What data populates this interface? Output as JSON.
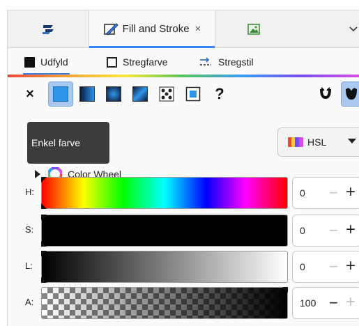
{
  "tabs": [
    {
      "label": "",
      "icon": "layers-icon"
    },
    {
      "label": "Fill and Stroke",
      "icon": "fill-stroke-icon",
      "close": "×",
      "active": true
    },
    {
      "label": "",
      "icon": "image-icon"
    }
  ],
  "more_menu_icon": "chevron-down-icon",
  "subtabs": [
    {
      "label": "Udfyld",
      "icon": "filled-square-icon",
      "active": true
    },
    {
      "label": "Stregfarve",
      "icon": "outline-square-icon"
    },
    {
      "label": "Stregstil",
      "icon": "stroke-style-icon"
    }
  ],
  "paint_types": {
    "none": "×",
    "unset": "?",
    "active": "flat-color"
  },
  "tooltip": {
    "text": "Enkel farve"
  },
  "color_mode": {
    "label": "HSL"
  },
  "color_wheel": {
    "label": "Color Wheel",
    "expanded": false
  },
  "sliders": [
    {
      "name": "H:",
      "value": "0",
      "minus_enabled": false,
      "plus_enabled": true
    },
    {
      "name": "S:",
      "value": "0",
      "minus_enabled": false,
      "plus_enabled": true
    },
    {
      "name": "L:",
      "value": "0",
      "minus_enabled": false,
      "plus_enabled": true
    },
    {
      "name": "A:",
      "value": "100",
      "minus_enabled": true,
      "plus_enabled": false
    }
  ],
  "accent_color": "#3b82f6"
}
